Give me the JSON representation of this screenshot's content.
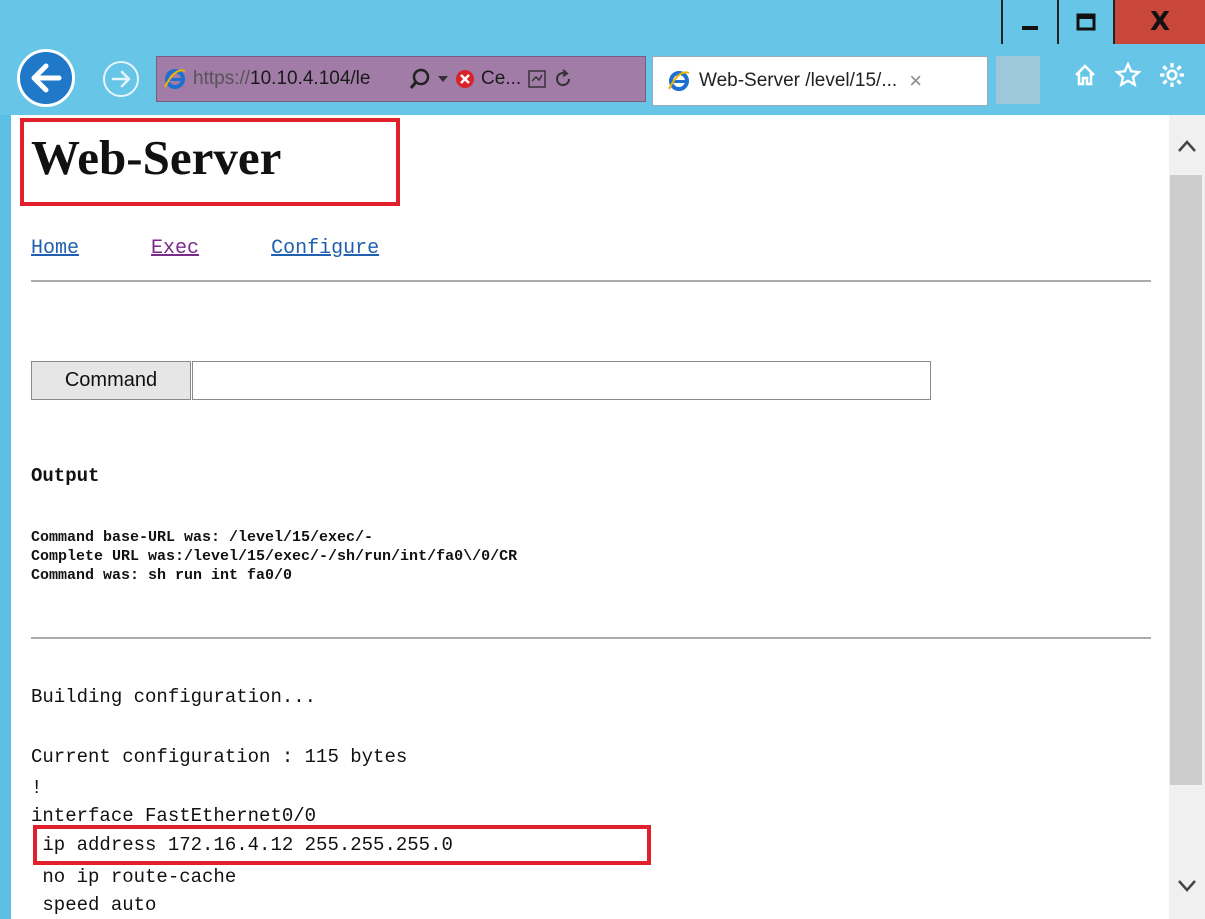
{
  "window": {
    "minimize_glyph": "▁",
    "maximize_glyph": "☐",
    "close_glyph": "X"
  },
  "address_bar": {
    "url_prefix": "https://",
    "url_host": "10.10.4.104/le",
    "cert_label": "Ce..."
  },
  "tab": {
    "title": "Web-Server /level/15/...",
    "close_glyph": "×"
  },
  "page": {
    "title": "Web-Server",
    "nav": {
      "home": "Home",
      "exec": "Exec",
      "configure": "Configure"
    },
    "command_button": "Command",
    "command_input_value": "",
    "output_heading": "Output",
    "info_lines": [
      "Command base-URL was: /level/15/exec/-",
      "Complete URL was:/level/15/exec/-/sh/run/int/fa0\\/0/CR",
      "Command was: sh run int fa0/0"
    ],
    "config_lines": [
      "Building configuration...",
      "",
      "Current configuration : 115 bytes",
      "!",
      "interface FastEthernet0/0",
      " ip address 172.16.4.12 255.255.255.0",
      " no ip route-cache",
      " speed auto"
    ]
  },
  "colors": {
    "chrome": "#67c6e8",
    "close_button": "#c9463b",
    "highlight_box": "#e0202a",
    "address_bar": "#a07ca6",
    "link": "#2060b0",
    "visited_link": "#7a2a8a"
  }
}
